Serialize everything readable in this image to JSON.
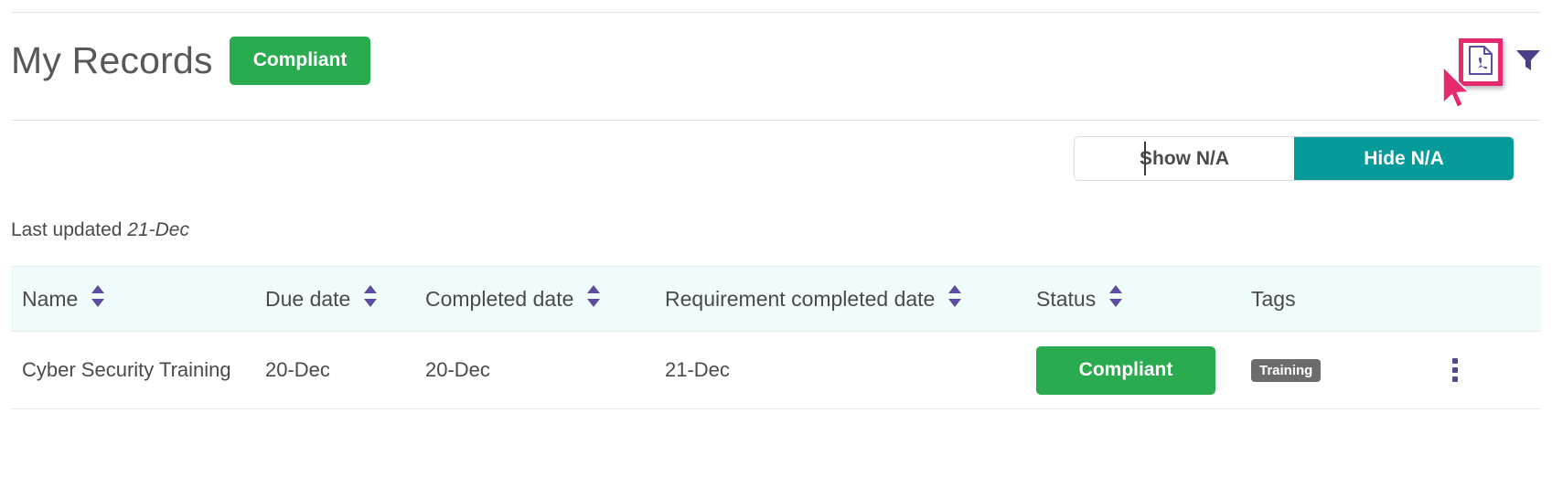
{
  "header": {
    "title": "My Records",
    "status_label": "Compliant",
    "status_color": "#2bab4f",
    "export_icon": "pdf-export-icon",
    "filter_icon": "filter-funnel-icon",
    "highlight_color": "#e52a6f"
  },
  "toggle": {
    "show_na_label": "Show N/A",
    "hide_na_label": "Hide N/A",
    "active": "Hide N/A",
    "active_color": "#079a9a"
  },
  "meta": {
    "last_updated_prefix": "Last updated",
    "last_updated_value": "21-Dec"
  },
  "table": {
    "columns": [
      {
        "label": "Name",
        "sortable": true
      },
      {
        "label": "Due date",
        "sortable": true
      },
      {
        "label": "Completed date",
        "sortable": true
      },
      {
        "label": "Requirement completed date",
        "sortable": true
      },
      {
        "label": "Status",
        "sortable": true
      },
      {
        "label": "Tags",
        "sortable": false
      }
    ],
    "rows": [
      {
        "name": "Cyber Security Training",
        "due_date": "20-Dec",
        "completed_date": "20-Dec",
        "requirement_completed_date": "21-Dec",
        "status": "Compliant",
        "status_color": "#2bab4f",
        "tag": "Training",
        "tag_color": "#6c6c6c",
        "menu_icon": "kebab-menu-icon"
      }
    ]
  },
  "colors": {
    "header_row_bg": "#effcfb",
    "sort_arrow": "#5b4ea0",
    "kebab": "#534a8f",
    "pdf_icon": "#5b4ea0",
    "funnel_icon": "#4b3f8c"
  }
}
